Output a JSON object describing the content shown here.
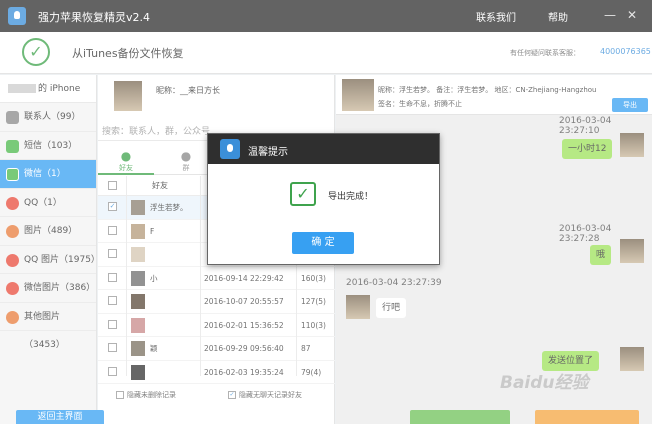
{
  "window": {
    "title": "强力苹果恢复精灵v2.4",
    "contact": "联系我们",
    "help": "帮助",
    "minimize": "—",
    "close": "✕"
  },
  "header": {
    "title": "从iTunes备份文件恢复",
    "service_label": "有任何疑问联系客服：",
    "qq": "4000076365"
  },
  "sidebar": {
    "device": "的 iPhone",
    "items": [
      {
        "label": "联系人（99）",
        "color": "#8a8a8a"
      },
      {
        "label": "短信（103）",
        "color": "#4cb84c"
      },
      {
        "label": "微信（1）",
        "color": "#4cb84c"
      },
      {
        "label": "QQ（1）",
        "color": "#e84c3d"
      },
      {
        "label": "图片（489）",
        "color": "#e87d3d"
      },
      {
        "label": "QQ 图片（1975）",
        "color": "#e84c3d"
      },
      {
        "label": "微信图片（386）",
        "color": "#e84c3d"
      },
      {
        "label": "其他图片（3453）",
        "color": "#e87d3d"
      }
    ]
  },
  "profile": {
    "nickname": "昵称：__来日方长"
  },
  "search": {
    "placeholder": "搜索：联系人，群，公众号"
  },
  "tabs": {
    "friends": "好友",
    "groups": "群"
  },
  "table": {
    "header_friend": "好友",
    "rows": [
      {
        "checked": true,
        "name": "浮生若梦。",
        "date": "",
        "count": ""
      },
      {
        "checked": false,
        "name": "F",
        "date": "",
        "count": ""
      },
      {
        "checked": false,
        "name": "",
        "date": "",
        "count": ""
      },
      {
        "checked": false,
        "name": "小",
        "date": "2016-09-14 22:29:42",
        "count": "160(3)"
      },
      {
        "checked": false,
        "name": "",
        "date": "2016-10-07 20:55:57",
        "count": "127(5)"
      },
      {
        "checked": false,
        "name": "",
        "date": "2016-02-01 15:36:52",
        "count": "110(3)"
      },
      {
        "checked": false,
        "name": "颖",
        "date": "2016-09-29 09:56:40",
        "count": "87"
      },
      {
        "checked": false,
        "name": "",
        "date": "2016-02-03 19:35:24",
        "count": "79(4)"
      }
    ]
  },
  "footer_options": {
    "hide_deleted": "隐藏未删除记录",
    "hide_no_chat": "隐藏无聊天记录好友"
  },
  "chat": {
    "head_line1": "昵称：浮生若梦。     备注：浮生若梦。      地区：CN-Zhejiang-Hangzhou",
    "head_line2": "签名：生命不息，折腾不止",
    "export_label": "导出",
    "messages": [
      {
        "time": "2016-03-04 23:27:10",
        "text": "一小时12"
      },
      {
        "time": "2016-03-04 23:27:28",
        "text": "哦"
      },
      {
        "time": "2016-03-04 23:27:39",
        "text": "行吧"
      },
      {
        "time": "",
        "text": "发送位置了"
      }
    ]
  },
  "bottom": {
    "back_label": "返回主界面"
  },
  "dialog": {
    "title": "温馨提示",
    "message": "导出完成！",
    "ok_label": "确 定"
  },
  "watermark": "Baidu经验"
}
